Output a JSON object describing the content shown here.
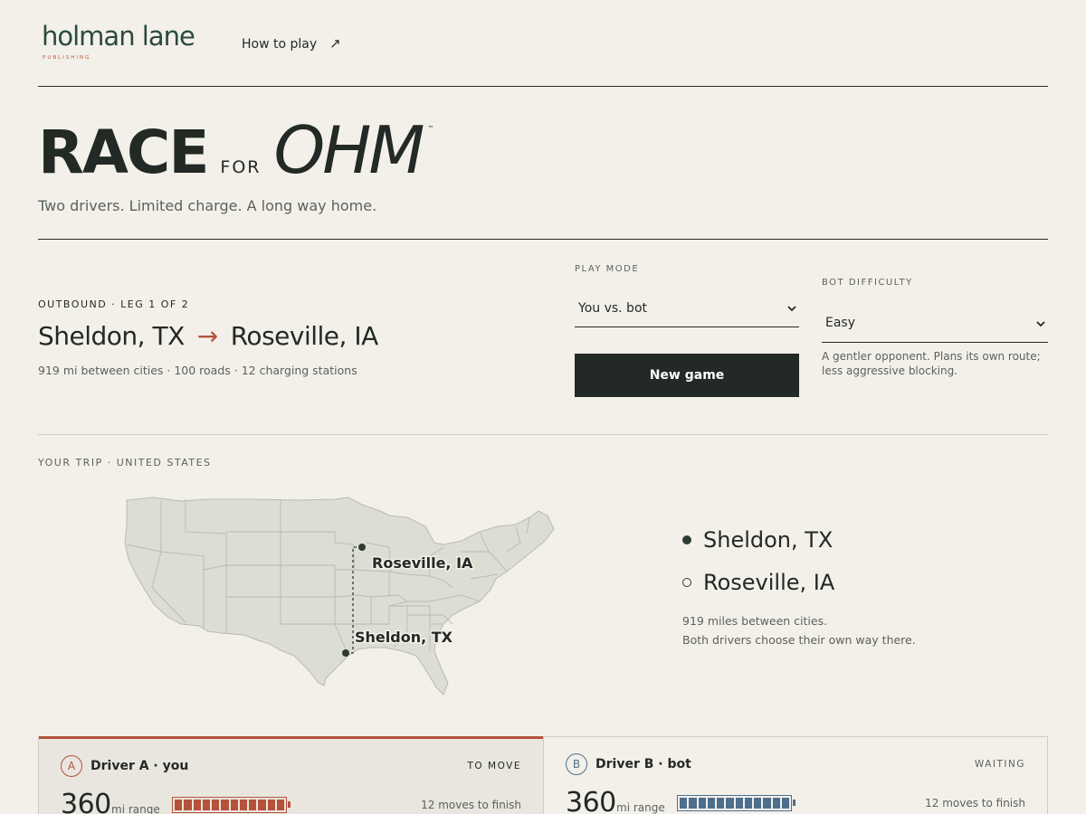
{
  "header": {
    "logo_name": "holman lane",
    "logo_sub": "PUBLISHING",
    "how_to_play": "How to play",
    "how_to_play_icon": "↗"
  },
  "hero": {
    "title_race": "RACE",
    "title_for": "FOR",
    "title_ohm": "OHM",
    "trademark": "™",
    "tagline": "Two drivers. Limited charge. A long way home."
  },
  "route": {
    "eyebrow": "OUTBOUND · LEG 1 OF 2",
    "origin": "Sheldon, TX",
    "arrow": "→",
    "destination": "Roseville, IA",
    "meta": "919 mi between cities · 100 roads · 12 charging stations"
  },
  "play_mode": {
    "label": "PLAY MODE",
    "selected": "You vs. bot",
    "new_game": "New game"
  },
  "bot_difficulty": {
    "label": "BOT DIFFICULTY",
    "selected": "Easy",
    "help": "A gentler opponent. Plans its own route; less aggressive blocking."
  },
  "trip": {
    "label": "YOUR TRIP · UNITED STATES",
    "map_origin_label": "Sheldon, TX",
    "map_destination_label": "Roseville, IA",
    "legend_origin": "Sheldon, TX",
    "legend_destination": "Roseville, IA",
    "note_line1": "919 miles between cities.",
    "note_line2": "Both drivers choose their own way there."
  },
  "drivers": {
    "a": {
      "badge": "A",
      "name": "Driver A · you",
      "status": "TO MOVE",
      "range": "360",
      "range_unit": "mi range",
      "moves": "12 moves to finish",
      "charge_fraction": 1.0
    },
    "b": {
      "badge": "B",
      "name": "Driver B · bot",
      "status": "WAITING",
      "range": "360",
      "range_unit": "mi range",
      "moves": "12 moves to finish",
      "charge_fraction": 1.0
    }
  },
  "colors": {
    "accent_rust": "#b5523a",
    "accent_blue": "#4d6f8e",
    "ink": "#232925",
    "background": "#f3f0ea"
  }
}
